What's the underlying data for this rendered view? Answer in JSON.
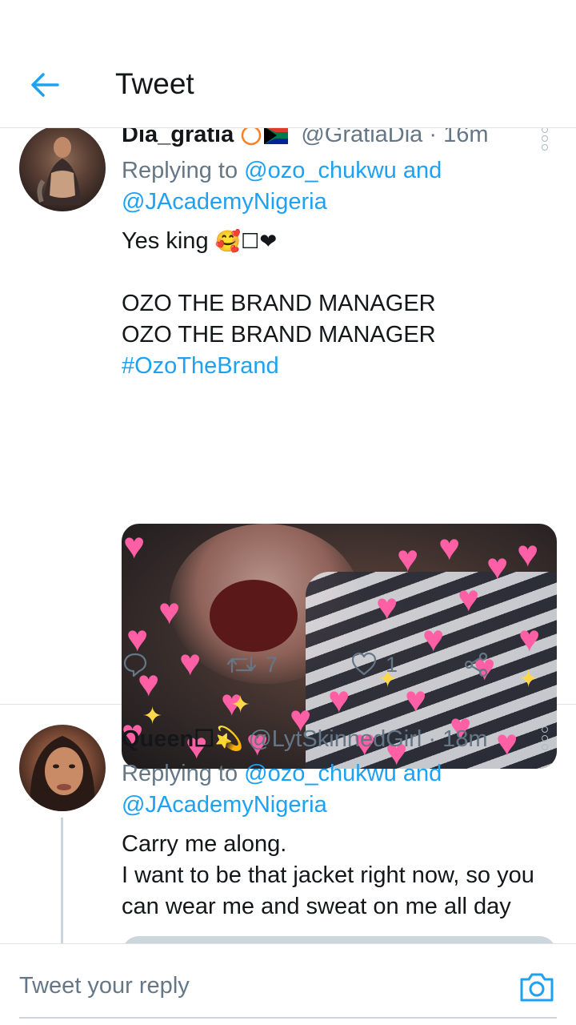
{
  "header": {
    "title": "Tweet"
  },
  "tweets": [
    {
      "name": "Dia_gratia",
      "handle": "@GratiaDia",
      "time": " · 16m",
      "replying_prefix": "Replying to ",
      "replying_users": "@ozo_chukwu and @JAcademyNigeria",
      "text_line1": "Yes king",
      "text_line1_emoji": "🥰☐❤",
      "text_line2": "OZO THE BRAND MANAGER",
      "text_line3": "OZO THE BRAND MANAGER",
      "hashtag": "#OzoTheBrand",
      "retweets": "7",
      "likes": "1"
    },
    {
      "name": "Queen☐💫",
      "handle": "@LytSkinnedGirl",
      "time": " · 18m",
      "replying_prefix": "Replying to ",
      "replying_users": "@ozo_chukwu and @JAcademyNigeria",
      "text_line1": "Carry me along.",
      "text_line2": "I want to be that jacket right now, so you",
      "text_line3": "can wear me and sweat on me all day"
    }
  ],
  "composer": {
    "placeholder": "Tweet your reply"
  },
  "colors": {
    "accent": "#1da1f2",
    "muted": "#657786",
    "heart": "#ff5fa5"
  },
  "icons": [
    "back-arrow-icon",
    "more-icon",
    "reply-icon",
    "retweet-icon",
    "like-icon",
    "share-icon",
    "camera-icon"
  ]
}
